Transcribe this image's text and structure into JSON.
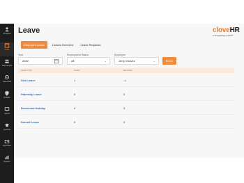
{
  "sidebar": {
    "items": [
      {
        "label": "All Issues",
        "icon": "user-icon"
      },
      {
        "label": "Leave",
        "icon": "calendar-icon"
      },
      {
        "label": "Recruitment",
        "icon": "people-icon"
      },
      {
        "label": "Help Desk",
        "icon": "headset-icon"
      },
      {
        "label": "Policies",
        "icon": "shield-icon"
      },
      {
        "label": "Assets",
        "icon": "monitor-icon"
      },
      {
        "label": "Learning",
        "icon": "graduation-icon"
      },
      {
        "label": "Expenses",
        "icon": "wallet-icon"
      },
      {
        "label": "Reports",
        "icon": "chart-icon"
      }
    ],
    "active_index": 1,
    "active_color": "#f08a3c"
  },
  "header": {
    "title": "Leave",
    "logo_main": "clove",
    "logo_accent": "HR",
    "logo_sub": "a Thoughtzgo product"
  },
  "tabs": [
    {
      "label": "Employee Leave",
      "active": true
    },
    {
      "label": "Leaves Overview",
      "active": false
    },
    {
      "label": "Leave Requests",
      "active": false
    }
  ],
  "filters": {
    "year": {
      "label": "Year",
      "value": "2022"
    },
    "status": {
      "label": "Employment Status",
      "value": "All"
    },
    "employee": {
      "label": "Employee",
      "value": "Jerry Chavez"
    },
    "reset_label": "Reset"
  },
  "table": {
    "headers": [
      "Leave Type",
      "Taken",
      "Balance"
    ],
    "rows": [
      {
        "type": "Sick Leave",
        "taken": "1",
        "balance": "-1"
      },
      {
        "type": "Paternity Leave",
        "taken": "0",
        "balance": "0"
      },
      {
        "type": "Restricted Holiday",
        "taken": "0",
        "balance": "3"
      },
      {
        "type": "Earned Leave",
        "taken": "0",
        "balance": "3"
      }
    ]
  },
  "colors": {
    "accent": "#f08a3c",
    "link": "#2f6fc5",
    "sidebar": "#1d1d1d"
  }
}
